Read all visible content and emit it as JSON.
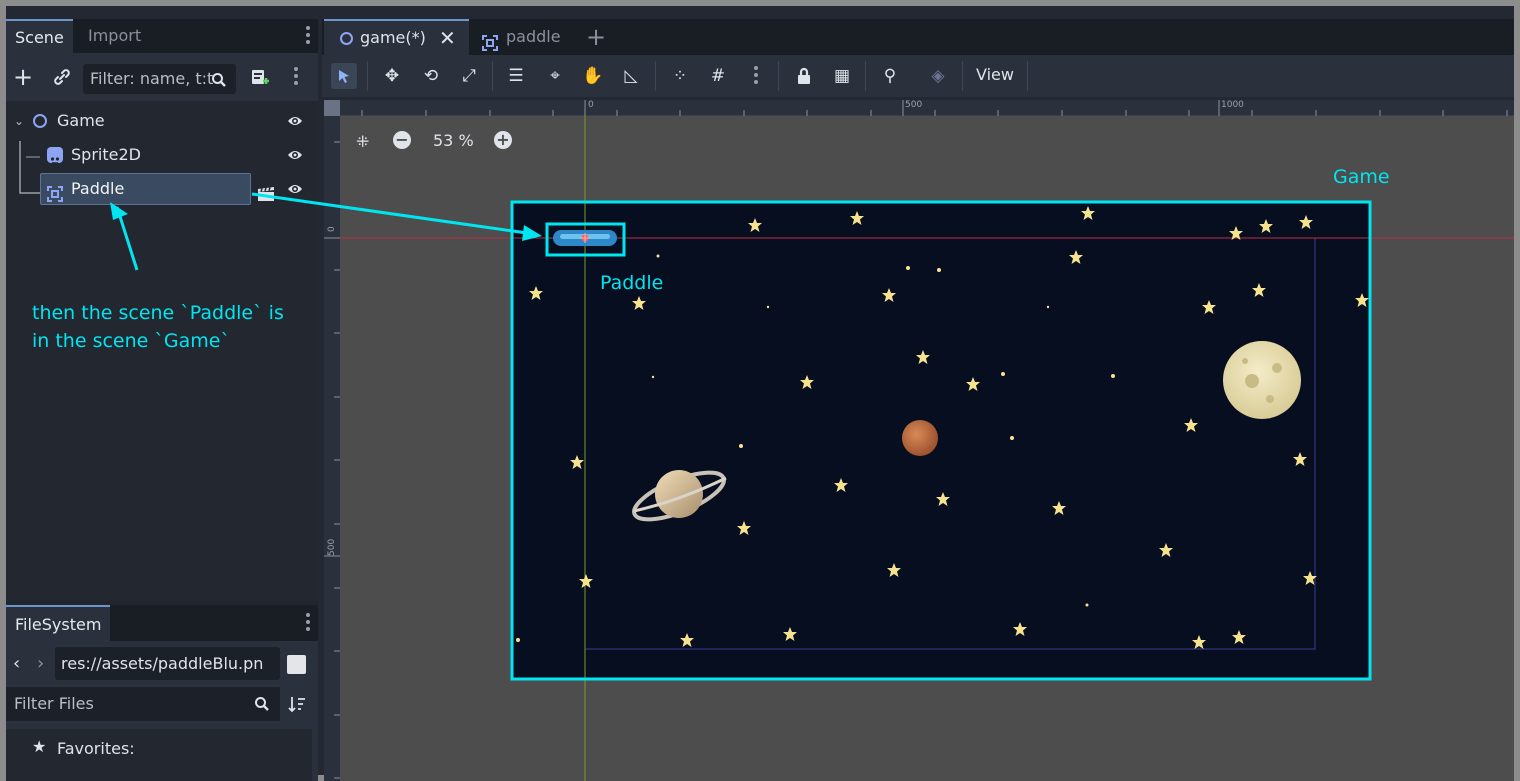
{
  "left_dock": {
    "tabs": [
      "Scene",
      "Import"
    ],
    "filter_placeholder": "Filter: name, t:t",
    "tree": [
      {
        "label": "Game",
        "icon": "node2d-icon"
      },
      {
        "label": "Sprite2D",
        "icon": "sprite2d-icon"
      },
      {
        "label": "Paddle",
        "icon": "instanced-scene-icon"
      }
    ]
  },
  "filesystem": {
    "tab": "FileSystem",
    "path": "res://assets/paddleBlu.pn",
    "filter_placeholder": "Filter Files",
    "favorites": "Favorites:"
  },
  "main_tabs": [
    {
      "label": "game(*)",
      "icon": "node2d-icon"
    },
    {
      "label": "paddle",
      "icon": "instanced-scene-icon"
    }
  ],
  "toolbar": {
    "view_label": "View"
  },
  "zoom": {
    "level": "53 %"
  },
  "rulers": {
    "top": [
      "0",
      "500",
      "1000"
    ],
    "left": [
      "0",
      "500"
    ]
  },
  "annotations": {
    "game_label": "Game",
    "paddle_label": "Paddle",
    "note_line1": "then the scene `Paddle` is",
    "note_line2": "in the scene `Game`"
  },
  "colors": {
    "annotation": "#00e5f0",
    "space_bg": "#060e1f",
    "accent": "#6c95d2"
  }
}
